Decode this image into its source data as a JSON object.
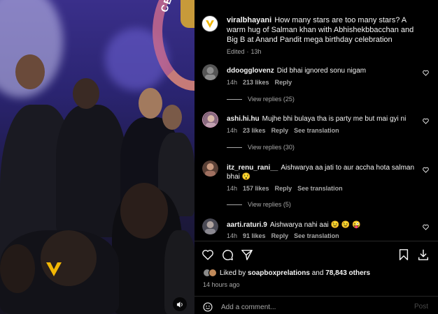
{
  "post": {
    "username": "viralbhayani",
    "caption": "How many stars are too many stars? A warm hug of Salman khan with Abhishekbbacchan and Big B at Anand Pandit mega birthday celebration",
    "edited": "Edited",
    "edited_age": "13h"
  },
  "media": {
    "ring_text": "CELE",
    "watermark_icon": "viral-bhayani-logo",
    "sound_icon": "speaker-icon"
  },
  "comments": [
    {
      "username": "ddoogglovenz",
      "text": "Did bhai ignored sonu nigam",
      "age": "14h",
      "likes": "213 likes",
      "reply": "Reply",
      "see_translation": "",
      "view_replies": "View replies (25)",
      "avatar_color": "#6b6b6b"
    },
    {
      "username": "ashi.hi.hu",
      "text": "Mujhe bhi bulaya tha is party me but mai gyi ni",
      "age": "14h",
      "likes": "23 likes",
      "reply": "Reply",
      "see_translation": "See translation",
      "view_replies": "View replies (30)",
      "avatar_color": "#b58aa6"
    },
    {
      "username": "itz_renu_rani__",
      "text": "Aishwarya aa jati to aur accha hota salman bhai 😯",
      "age": "14h",
      "likes": "157 likes",
      "reply": "Reply",
      "see_translation": "See translation",
      "view_replies": "View replies (5)",
      "avatar_color": "#8a6a5a"
    },
    {
      "username": "aarti.raturi.9",
      "text": "Aishwarya nahi aai 😉 😉 😜",
      "age": "14h",
      "likes": "91 likes",
      "reply": "Reply",
      "see_translation": "See translation",
      "view_replies": "",
      "avatar_color": "#7d7d88"
    }
  ],
  "likes": {
    "prefix": "Liked by",
    "user": "soapboxprelations",
    "and": "and",
    "count": "78,843 others",
    "time": "14 hours ago"
  },
  "composer": {
    "placeholder": "Add a comment...",
    "post_label": "Post"
  },
  "colors": {
    "background": "#000000",
    "secondary_text": "#a8a8a8",
    "post_button_disabled": "#4a4a4a"
  }
}
